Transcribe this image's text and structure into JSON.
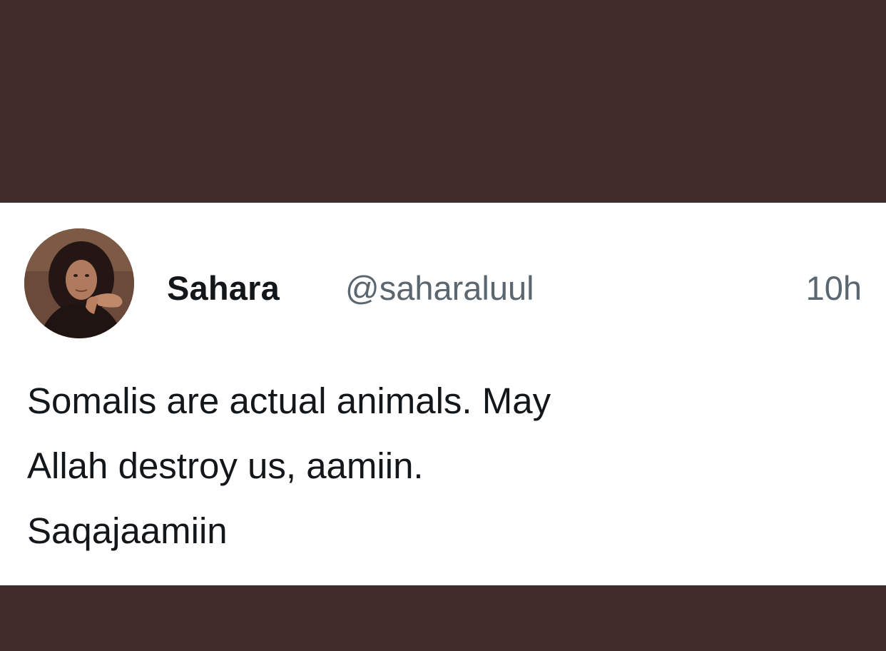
{
  "tweet": {
    "author": {
      "display_name": "Sahara",
      "handle": "@saharaluul",
      "avatar_icon": "profile-photo"
    },
    "time_ago": "10h",
    "text_lines": [
      "Somalis are actual animals. May",
      "Allah destroy us, aamiin.",
      "Saqajaamiin"
    ]
  },
  "colors": {
    "background_band": "#3f2c2b",
    "card": "#ffffff",
    "primary_text": "#14171a",
    "secondary_text": "#5b6770"
  }
}
